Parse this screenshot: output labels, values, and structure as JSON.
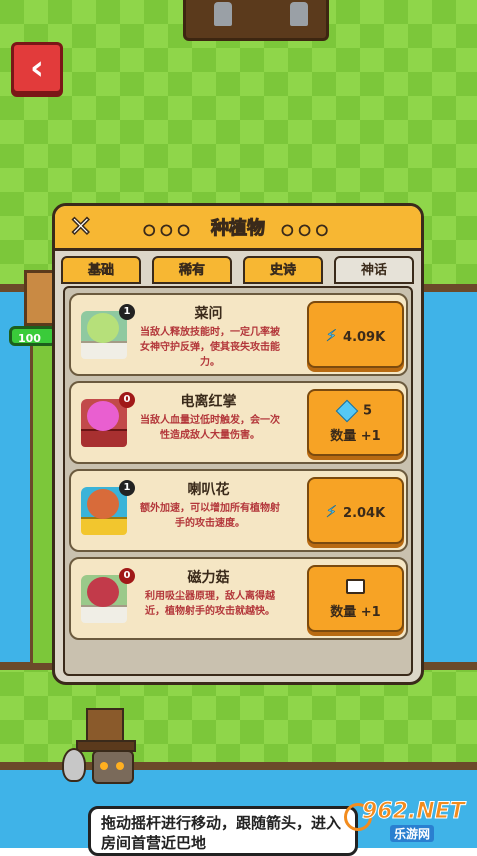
{
  "scene": {
    "hp_value": "100"
  },
  "panel": {
    "title": "种植物",
    "title_dots": "○○○",
    "tabs": [
      {
        "label": "基础",
        "active": false
      },
      {
        "label": "稀有",
        "active": false
      },
      {
        "label": "史诗",
        "active": false
      },
      {
        "label": "神话",
        "active": true
      }
    ],
    "plants": [
      {
        "level": "1",
        "name": "菜问",
        "desc": "当敌人释放技能时，一定几率被女神守护反弹，使其丧失攻击能力。",
        "price_icon": "energy-bolt-icon",
        "price": "4.09K",
        "qty_label": ""
      },
      {
        "level": "0",
        "name": "电离红掌",
        "desc": "当敌人血量过低时触发，会一次性造成敌人大量伤害。",
        "price_icon": "diamond-icon",
        "price": "5",
        "qty_label": "数量 +1"
      },
      {
        "level": "1",
        "name": "喇叭花",
        "desc": "额外加速，可以增加所有植物射手的攻击速度。",
        "price_icon": "energy-bolt-icon",
        "price": "2.04K",
        "qty_label": ""
      },
      {
        "level": "0",
        "name": "磁力菇",
        "desc": "利用吸尘器原理，敌人离得越近，植物射手的攻击就越快。",
        "price_icon": "video-camera-icon",
        "price": "",
        "qty_label": "数量 +1"
      }
    ]
  },
  "tutorial": {
    "speech": "拖动摇杆进行移动，跟随箭头，进入房间首营近巴地"
  },
  "watermark": {
    "main": "962.NET",
    "sub": "乐游网"
  },
  "colors": {
    "panel_header": "#f7b733",
    "button": "#f7a325",
    "back_button": "#e23b3b",
    "river": "#3fb3e8",
    "grass": "#7cc73a"
  }
}
